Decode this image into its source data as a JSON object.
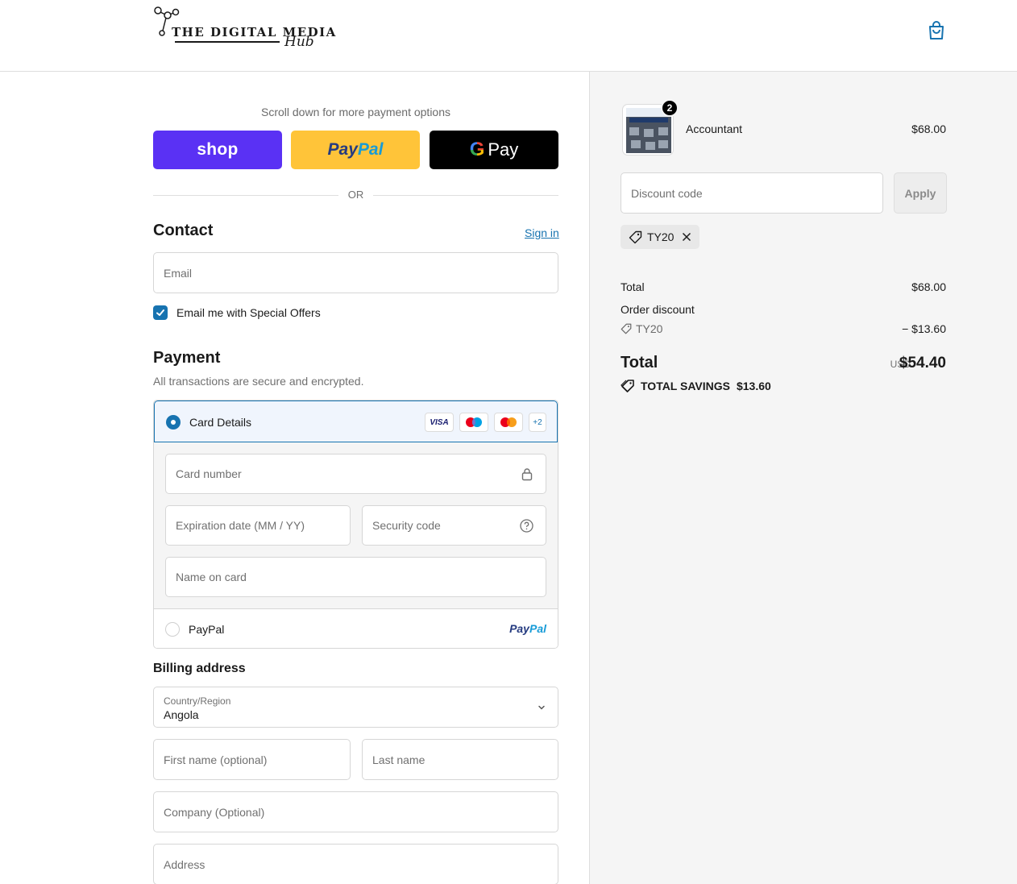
{
  "header": {
    "logo_main": "THE DIGITAL MEDIA",
    "logo_sub": "Hub",
    "cart_icon": "shopping-bag-icon"
  },
  "express": {
    "note": "Scroll down for more payment options",
    "shop_label": "shop",
    "paypal_label_1": "Pay",
    "paypal_label_2": "Pal",
    "gpay_g": "G",
    "gpay_label": "Pay",
    "or_label": "OR"
  },
  "contact": {
    "title": "Contact",
    "sign_in": "Sign in",
    "email_placeholder": "Email",
    "email_offers_label": "Email me with Special Offers",
    "email_offers_checked": true
  },
  "payment": {
    "title": "Payment",
    "subtitle": "All transactions are secure and encrypted.",
    "card_option_label": "Card Details",
    "card_brands": [
      "VISA",
      "maestro",
      "mastercard",
      "+2"
    ],
    "card_number_placeholder": "Card number",
    "expiration_placeholder": "Expiration date (MM / YY)",
    "security_code_placeholder": "Security code",
    "name_on_card_placeholder": "Name on card",
    "paypal_option_label": "PayPal",
    "paypal_logo_1": "Pay",
    "paypal_logo_2": "Pal",
    "selected": "card",
    "brand_color": "#1773b0"
  },
  "billing": {
    "title": "Billing address",
    "country_label": "Country/Region",
    "country_value": "Angola",
    "first_name_placeholder": "First name (optional)",
    "last_name_placeholder": "Last name",
    "company_placeholder": "Company (Optional)",
    "address_placeholder": "Address"
  },
  "summary": {
    "item": {
      "name": "Accountant",
      "price": "$68.00",
      "quantity": "2"
    },
    "discount_placeholder": "Discount code",
    "apply_label": "Apply",
    "applied_code": "TY20",
    "total_label": "Total",
    "total_value": "$68.00",
    "order_discount_label": "Order discount",
    "order_discount_code": "TY20",
    "order_discount_value": "− $13.60",
    "grand_total_label": "Total",
    "currency": "USD",
    "grand_total_value": "$54.40",
    "savings_label": "TOTAL SAVINGS",
    "savings_value": "$13.60"
  }
}
